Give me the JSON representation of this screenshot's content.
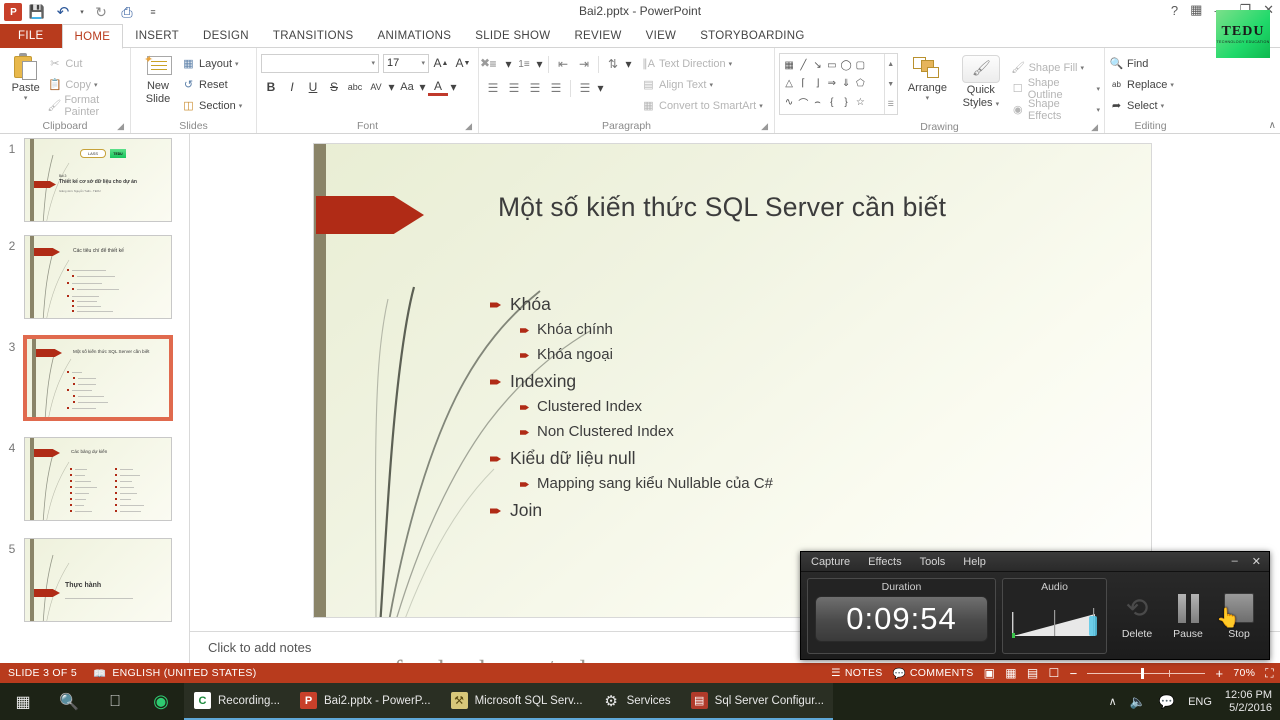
{
  "window": {
    "title": "Bai2.pptx - PowerPoint",
    "help_icon": "?",
    "ribbon_display_icon": "ribbon-display-options-icon",
    "minimize": "—",
    "restore": "❐",
    "close": "✕"
  },
  "quick_access": {
    "app_logo": "P",
    "items": [
      {
        "name": "save-icon",
        "glyph": "💾"
      },
      {
        "name": "undo-icon",
        "glyph": "↶"
      },
      {
        "name": "undo-dropdown-icon",
        "glyph": "▾"
      },
      {
        "name": "redo-icon",
        "glyph": "↻"
      },
      {
        "name": "start-from-beginning-icon",
        "glyph": "⎙"
      },
      {
        "name": "customize-quick-access-icon",
        "glyph": "≡"
      }
    ]
  },
  "ribbon": {
    "tabs": [
      {
        "label": "FILE",
        "state": "file"
      },
      {
        "label": "HOME",
        "state": "active"
      },
      {
        "label": "INSERT",
        "state": "normal"
      },
      {
        "label": "DESIGN",
        "state": "normal"
      },
      {
        "label": "TRANSITIONS",
        "state": "normal"
      },
      {
        "label": "ANIMATIONS",
        "state": "normal"
      },
      {
        "label": "SLIDE SHOW",
        "state": "normal"
      },
      {
        "label": "REVIEW",
        "state": "normal"
      },
      {
        "label": "VIEW",
        "state": "normal"
      },
      {
        "label": "STORYBOARDING",
        "state": "normal"
      }
    ],
    "groups": {
      "clipboard": {
        "label": "Clipboard",
        "paste": "Paste",
        "cut": "Cut",
        "copy": "Copy",
        "format_painter": "Format Painter"
      },
      "slides": {
        "label": "Slides",
        "new_slide_line1": "New",
        "new_slide_line2": "Slide",
        "layout": "Layout",
        "reset": "Reset",
        "section": "Section"
      },
      "font": {
        "label": "Font",
        "font_name_value": "",
        "font_size_value": "17",
        "grow_font": "A",
        "shrink_font": "A",
        "clear_formatting": "clear-formatting-icon",
        "bold": "B",
        "italic": "I",
        "underline": "U",
        "strikethrough": "S",
        "shadow": "abc",
        "spacing": "AV",
        "change_case": "Aa",
        "font_color": "A"
      },
      "paragraph": {
        "label": "Paragraph",
        "text_direction": "Text Direction",
        "align_text": "Align Text",
        "convert_to_smartart": "Convert to SmartArt"
      },
      "drawing": {
        "label": "Drawing",
        "arrange": "Arrange",
        "quick_styles_line1": "Quick",
        "quick_styles_line2": "Styles",
        "shape_fill": "Shape Fill",
        "shape_outline": "Shape Outline",
        "shape_effects": "Shape Effects",
        "shapes": [
          "⊞",
          "╲",
          "↘",
          "▭",
          "◯",
          "▢",
          "△",
          "⌐",
          "┗",
          "⇨",
          "⇩",
          "⬒",
          "∂",
          "⌒",
          "⌢",
          "{",
          "}",
          "☆"
        ]
      },
      "editing": {
        "label": "Editing",
        "find": "Find",
        "replace": "Replace",
        "select": "Select"
      }
    },
    "collapse_icon": "∧"
  },
  "thumbnails": [
    {
      "number": "1",
      "selected": false,
      "title": "Thiết kế cơ sở dữ liệu cho dự án",
      "eyebrow": "Bài 2:",
      "subtitle": "Giảng viên: Nguyễn Tuấn - TEDU",
      "logo": "TYLASS TEDU"
    },
    {
      "number": "2",
      "selected": false,
      "title": "Các tiêu chí để thiết kế"
    },
    {
      "number": "3",
      "selected": true,
      "title": "Một số kiến thức SQL Server cần biết"
    },
    {
      "number": "4",
      "selected": false,
      "title": "Các bảng dự kiến"
    },
    {
      "number": "5",
      "selected": false,
      "title": "Thực hành"
    }
  ],
  "slide": {
    "title": "Một số kiến thức SQL Server cần biết",
    "bullets": [
      {
        "level": 1,
        "text": "Khóa"
      },
      {
        "level": 2,
        "text": "Khóa chính"
      },
      {
        "level": 2,
        "text": "Khóa ngoại"
      },
      {
        "level": 1,
        "text": "Indexing"
      },
      {
        "level": 2,
        "text": "Clustered Index"
      },
      {
        "level": 2,
        "text": "Non Clustered Index"
      },
      {
        "level": 1,
        "text": "Kiểu dữ liệu null"
      },
      {
        "level": 2,
        "text": "Mapping sang kiểu Nullable của C#"
      },
      {
        "level": 1,
        "text": "Join"
      }
    ]
  },
  "notes": {
    "placeholder": "Click to add notes"
  },
  "watermark": {
    "text": "www.facebook.com/tedu.com.vn"
  },
  "status_bar": {
    "slide_counter": "SLIDE 3 OF 5",
    "spellcheck_icon": "proofing-icon",
    "language": "ENGLISH (UNITED STATES)",
    "notes_label": "NOTES",
    "notes_icon": "notes-icon",
    "comments_label": "COMMENTS",
    "comments_icon": "comments-icon",
    "view_normal_icon": "normal-view-icon",
    "view_sorter_icon": "slide-sorter-icon",
    "view_reading_icon": "reading-view-icon",
    "view_slideshow_icon": "slide-show-icon",
    "zoom_out": "−",
    "zoom_in": "+",
    "zoom_level": "70%",
    "fit_slide_icon": "fit-to-window-icon"
  },
  "recorder": {
    "menus": [
      "Capture",
      "Effects",
      "Tools",
      "Help"
    ],
    "minimize": "–",
    "close": "✕",
    "duration_label": "Duration",
    "duration_value": "0:09:54",
    "audio_label": "Audio",
    "buttons": [
      {
        "name": "delete-button",
        "label": "Delete"
      },
      {
        "name": "pause-button",
        "label": "Pause"
      },
      {
        "name": "stop-button",
        "label": "Stop"
      }
    ]
  },
  "taskbar": {
    "start_icon": "windows-start-icon",
    "search_icon": "search-icon",
    "task_view_icon": "task-view-icon",
    "camtasia_icon": "camtasia-recorder-icon",
    "apps": [
      {
        "name": "taskbar-item-recording",
        "label": "Recording...",
        "icon": "camtasia-icon",
        "icon_glyph": "C",
        "icon_bg": "#ffffff",
        "icon_color": "#1c8a3c"
      },
      {
        "name": "taskbar-item-powerpoint",
        "label": "Bai2.pptx - PowerP...",
        "icon": "powerpoint-icon",
        "icon_glyph": "P",
        "icon_bg": "#c8402a",
        "icon_color": "#ffffff"
      },
      {
        "name": "taskbar-item-ssms",
        "label": "Microsoft SQL Serv...",
        "icon": "sql-server-management-studio-icon",
        "icon_glyph": "⛏",
        "icon_bg": "#d8c87a",
        "icon_color": "#5a4a10"
      },
      {
        "name": "taskbar-item-services",
        "label": "Services",
        "icon": "services-gear-icon",
        "icon_glyph": "⚙",
        "icon_bg": "#2b2b2b",
        "icon_color": "#e8e8e8"
      },
      {
        "name": "taskbar-item-sqlconfig",
        "label": "Sql Server Configur...",
        "icon": "sql-server-configuration-icon",
        "icon_glyph": "▤",
        "icon_bg": "#b03a2a",
        "icon_color": "#ffffff"
      }
    ],
    "tray": {
      "show_hidden_icon": "∧",
      "volume_icon": "🔊",
      "action_center_icon": "💬",
      "language": "ENG",
      "time": "12:06 PM",
      "date": "5/2/2016"
    }
  },
  "colors": {
    "accent_red": "#b83b1d",
    "slide_arrow_red": "#b02b16",
    "slide_bg": "#eef1dc",
    "taskbar_bg": "#1d2316",
    "tedu_green": "#3ddc84"
  }
}
